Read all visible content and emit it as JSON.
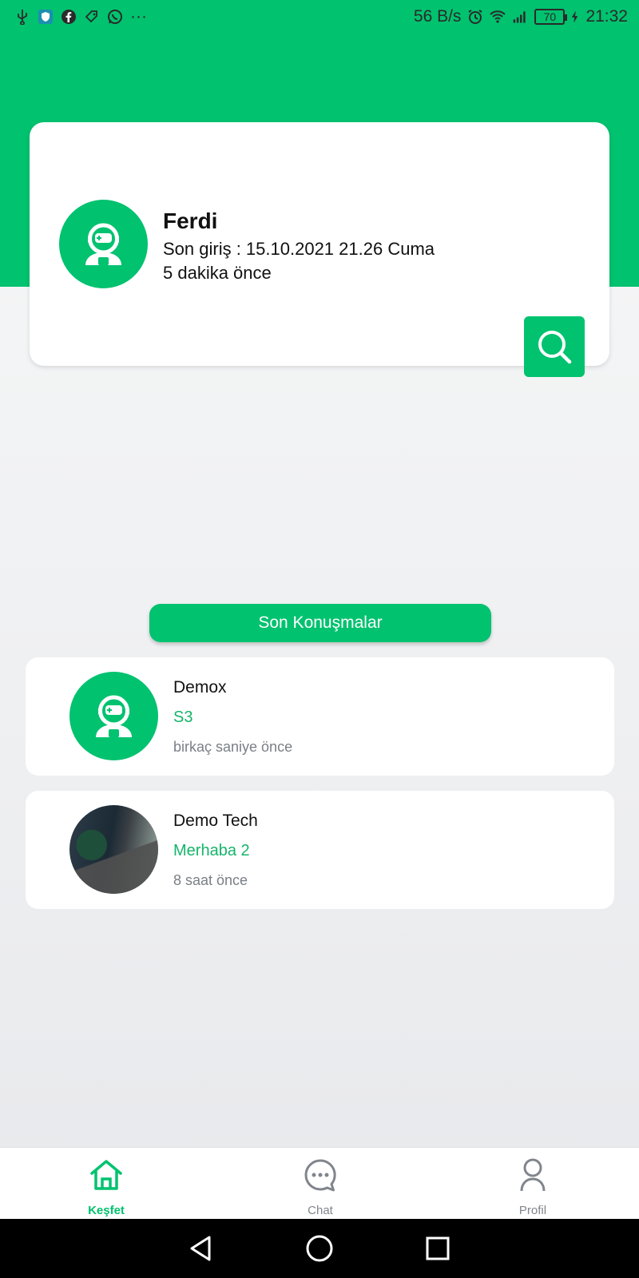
{
  "status_bar": {
    "speed": "56 B/s",
    "battery": "70",
    "time": "21:32",
    "more": "···"
  },
  "profile": {
    "name": "Ferdi",
    "last_login": "Son giriş : 15.10.2021 21.26 Cuma",
    "ago": "5 dakika önce"
  },
  "recent_button_label": "Son Konuşmalar",
  "conversations": [
    {
      "name": "Demox",
      "message": "S3",
      "time": "birkaç saniye önce",
      "avatar": "robot-avatar"
    },
    {
      "name": "Demo Tech",
      "message": "Merhaba 2",
      "time": "8 saat önce",
      "avatar": "photo-avatar"
    }
  ],
  "bottom_nav": [
    {
      "label": "Keşfet",
      "icon": "home-icon",
      "active": true
    },
    {
      "label": "Chat",
      "icon": "chat-icon",
      "active": false
    },
    {
      "label": "Profil",
      "icon": "profile-icon",
      "active": false
    }
  ],
  "colors": {
    "accent": "#00c26f",
    "message_text": "#16b46a",
    "muted_text": "#7a7f86"
  }
}
